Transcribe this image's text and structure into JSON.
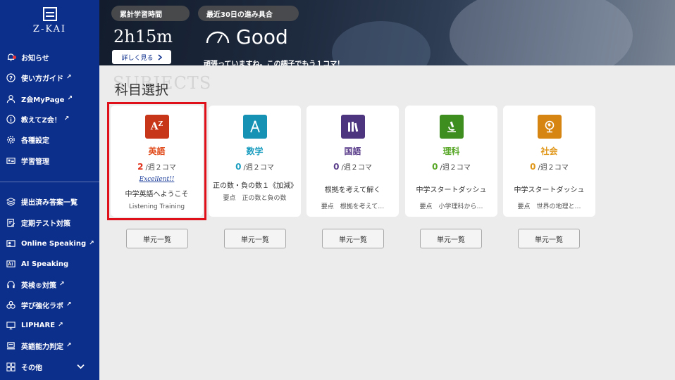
{
  "sidebar": {
    "logo": "Z-KAI",
    "items": [
      {
        "label": "お知らせ",
        "icon": "bell-icon",
        "ext": ""
      },
      {
        "label": "使い方ガイド",
        "icon": "help-circle-icon",
        "ext": "↗"
      },
      {
        "label": "Z会MyPage",
        "icon": "user-icon",
        "ext": "↗"
      },
      {
        "label": "教えてZ会！",
        "icon": "info-icon",
        "ext": "↗"
      },
      {
        "label": "各種設定",
        "icon": "gear-icon",
        "ext": ""
      },
      {
        "label": "学習管理",
        "icon": "id-card-icon",
        "ext": ""
      },
      {
        "label": "提出済み答案一覧",
        "icon": "layers-icon",
        "ext": ""
      },
      {
        "label": "定期テスト対策",
        "icon": "edit-doc-icon",
        "ext": ""
      },
      {
        "label": "Online Speaking",
        "icon": "speaking-icon",
        "ext": "↗"
      },
      {
        "label": "AI Speaking",
        "icon": "ai-speaking-icon",
        "ext": ""
      },
      {
        "label": "英検®対策",
        "icon": "headset-icon",
        "ext": "↗"
      },
      {
        "label": "学び強化ラボ",
        "icon": "flask-icon",
        "ext": "↗"
      },
      {
        "label": "LIPHARE",
        "icon": "monitor-icon",
        "ext": "↗"
      },
      {
        "label": "英語能力判定",
        "icon": "pc-icon",
        "ext": "↗"
      },
      {
        "label": "その他",
        "icon": "grid-icon",
        "ext": ""
      }
    ],
    "more_chevron": "⌄"
  },
  "hero": {
    "study_time_label": "累計学習時間",
    "study_time_value": "2h15m",
    "detail_button": "詳しく見る",
    "progress_label": "最近30日の進み具合",
    "progress_value": "Good",
    "message": "頑張っていますね。この調子でもう１コマ！"
  },
  "section": {
    "bg_text": "SUBJECTS",
    "title": "科目選択"
  },
  "subjects": [
    {
      "name": "英語",
      "icon_text": "A",
      "color": "#e04a1a",
      "icon_bg": "#c8361a",
      "count": "2",
      "count_color": "#e0301a",
      "per_week": "/週２コマ",
      "badge": "Excellent!!",
      "unit": "中学英語へようこそ",
      "sub": "Listening Training"
    },
    {
      "name": "数学",
      "icon_text": "△",
      "color": "#1b9dc0",
      "icon_bg": "#1692b5",
      "count": "0",
      "count_color": "#1b9dc0",
      "per_week": "/週２コマ",
      "badge": "",
      "unit": "正の数・負の数１《加減》",
      "sub": "要点　正の数と負の数"
    },
    {
      "name": "国語",
      "icon_text": "▮▮",
      "color": "#5a3d8a",
      "icon_bg": "#4e3580",
      "count": "0",
      "count_color": "#5a3d8a",
      "per_week": "/週２コマ",
      "badge": "",
      "unit": "根拠を考えて解く",
      "sub": "要点　根拠を考えて…"
    },
    {
      "name": "理科",
      "icon_text": "⚗",
      "color": "#5aa82a",
      "icon_bg": "#3e8d1f",
      "count": "0",
      "count_color": "#5aa82a",
      "per_week": "/週２コマ",
      "badge": "",
      "unit": "中学スタートダッシュ",
      "sub": "要点　小学理科から…"
    },
    {
      "name": "社会",
      "icon_text": "◉",
      "color": "#e0971a",
      "icon_bg": "#d68412",
      "count": "0",
      "count_color": "#e0971a",
      "per_week": "/週２コマ",
      "badge": "",
      "unit": "中学スタートダッシュ",
      "sub": "要点　世界の地理と…"
    }
  ],
  "unit_list_label": "単元一覧"
}
